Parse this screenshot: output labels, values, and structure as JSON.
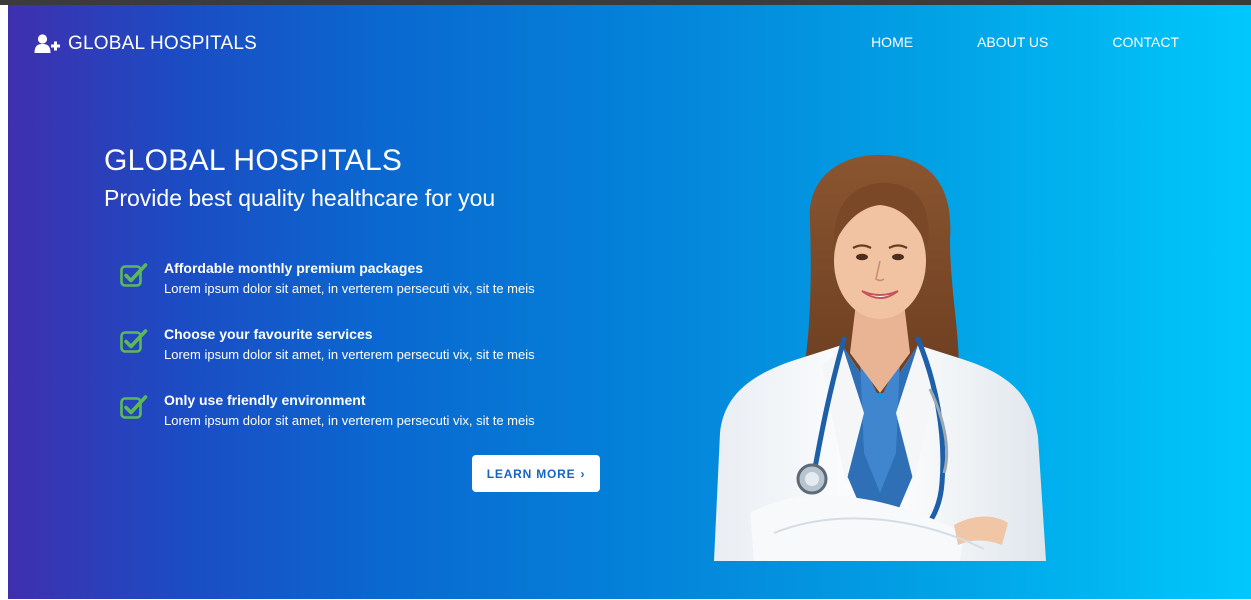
{
  "brand": {
    "name": "GLOBAL HOSPITALS",
    "icon": "user-plus-icon"
  },
  "nav": {
    "items": [
      "HOME",
      "ABOUT US",
      "CONTACT"
    ]
  },
  "hero": {
    "title": "GLOBAL HOSPITALS",
    "subtitle": "Provide best quality healthcare for you",
    "features": [
      {
        "title": "Affordable monthly premium packages",
        "desc": "Lorem ipsum dolor sit amet, in verterem persecuti vix, sit te meis",
        "icon": "check-square-icon"
      },
      {
        "title": "Choose your favourite services",
        "desc": "Lorem ipsum dolor sit amet, in verterem persecuti vix, sit te meis",
        "icon": "check-square-icon"
      },
      {
        "title": "Only use friendly environment",
        "desc": "Lorem ipsum dolor sit amet, in verterem persecuti vix, sit te meis",
        "icon": "check-square-icon"
      }
    ],
    "cta": {
      "label": "LEARN MORE",
      "chevron": "›"
    }
  },
  "colors": {
    "gradient_start": "#3f2fae",
    "gradient_mid": "#0481d9",
    "gradient_end": "#00c8fc",
    "check_green": "#5cb85c",
    "button_text": "#1565c0"
  }
}
